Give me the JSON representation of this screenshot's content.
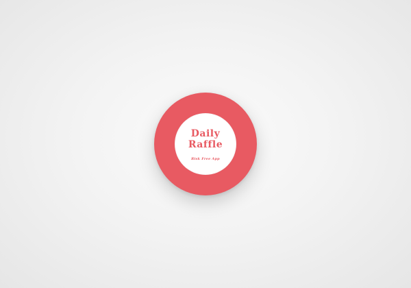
{
  "logo": {
    "title_line1": "Daily",
    "title_line2": "Raffle",
    "tagline": "Risk Free App"
  },
  "colors": {
    "accent": "#e85a62",
    "inner_background": "#ffffff",
    "page_background": "#f3f3f3"
  }
}
